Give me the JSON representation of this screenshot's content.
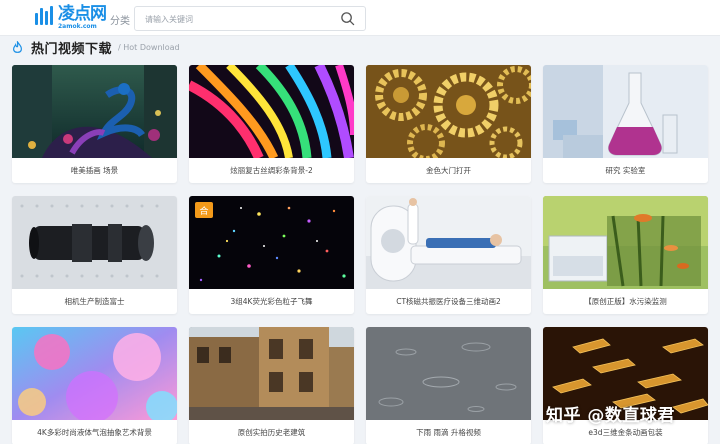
{
  "header": {
    "logo_name": "凌点网",
    "logo_sub": "2amok.com",
    "nav_category": "分类",
    "search_placeholder": "请输入关键词"
  },
  "section": {
    "title": "热门视频下载",
    "subtitle": "/ Hot Download"
  },
  "cards": [
    {
      "title": "唯美插画 场景",
      "thumb": "peacock-illustration"
    },
    {
      "title": "炫丽复古丝绸彩条背景-2",
      "thumb": "colorful-silk-stripes"
    },
    {
      "title": "金色大门打开",
      "thumb": "golden-gears-door"
    },
    {
      "title": "研究 实验室",
      "thumb": "lab-flask"
    },
    {
      "title": "相机生产制造富士",
      "thumb": "camera-lens"
    },
    {
      "title": "3组4K荧光彩色粒子飞舞",
      "thumb": "color-particles",
      "badge": "合"
    },
    {
      "title": "CT核磁共振医疗设备三维动画2",
      "thumb": "ct-scanner"
    },
    {
      "title": "【原创正版】水污染监测",
      "thumb": "aquarium-monitoring"
    },
    {
      "title": "4K多彩时尚液体气泡抽象艺术背景",
      "thumb": "liquid-bubbles"
    },
    {
      "title": "原创实拍历史老建筑",
      "thumb": "old-buildings"
    },
    {
      "title": "下雨 雨滴 升格视频",
      "thumb": "raindrops"
    },
    {
      "title": "e3d三维金条动画包装",
      "thumb": "gold-bars"
    }
  ],
  "watermark": "知乎 @数直球君",
  "colors": {
    "brand": "#1a8fe6",
    "badge": "#f39a1a"
  }
}
